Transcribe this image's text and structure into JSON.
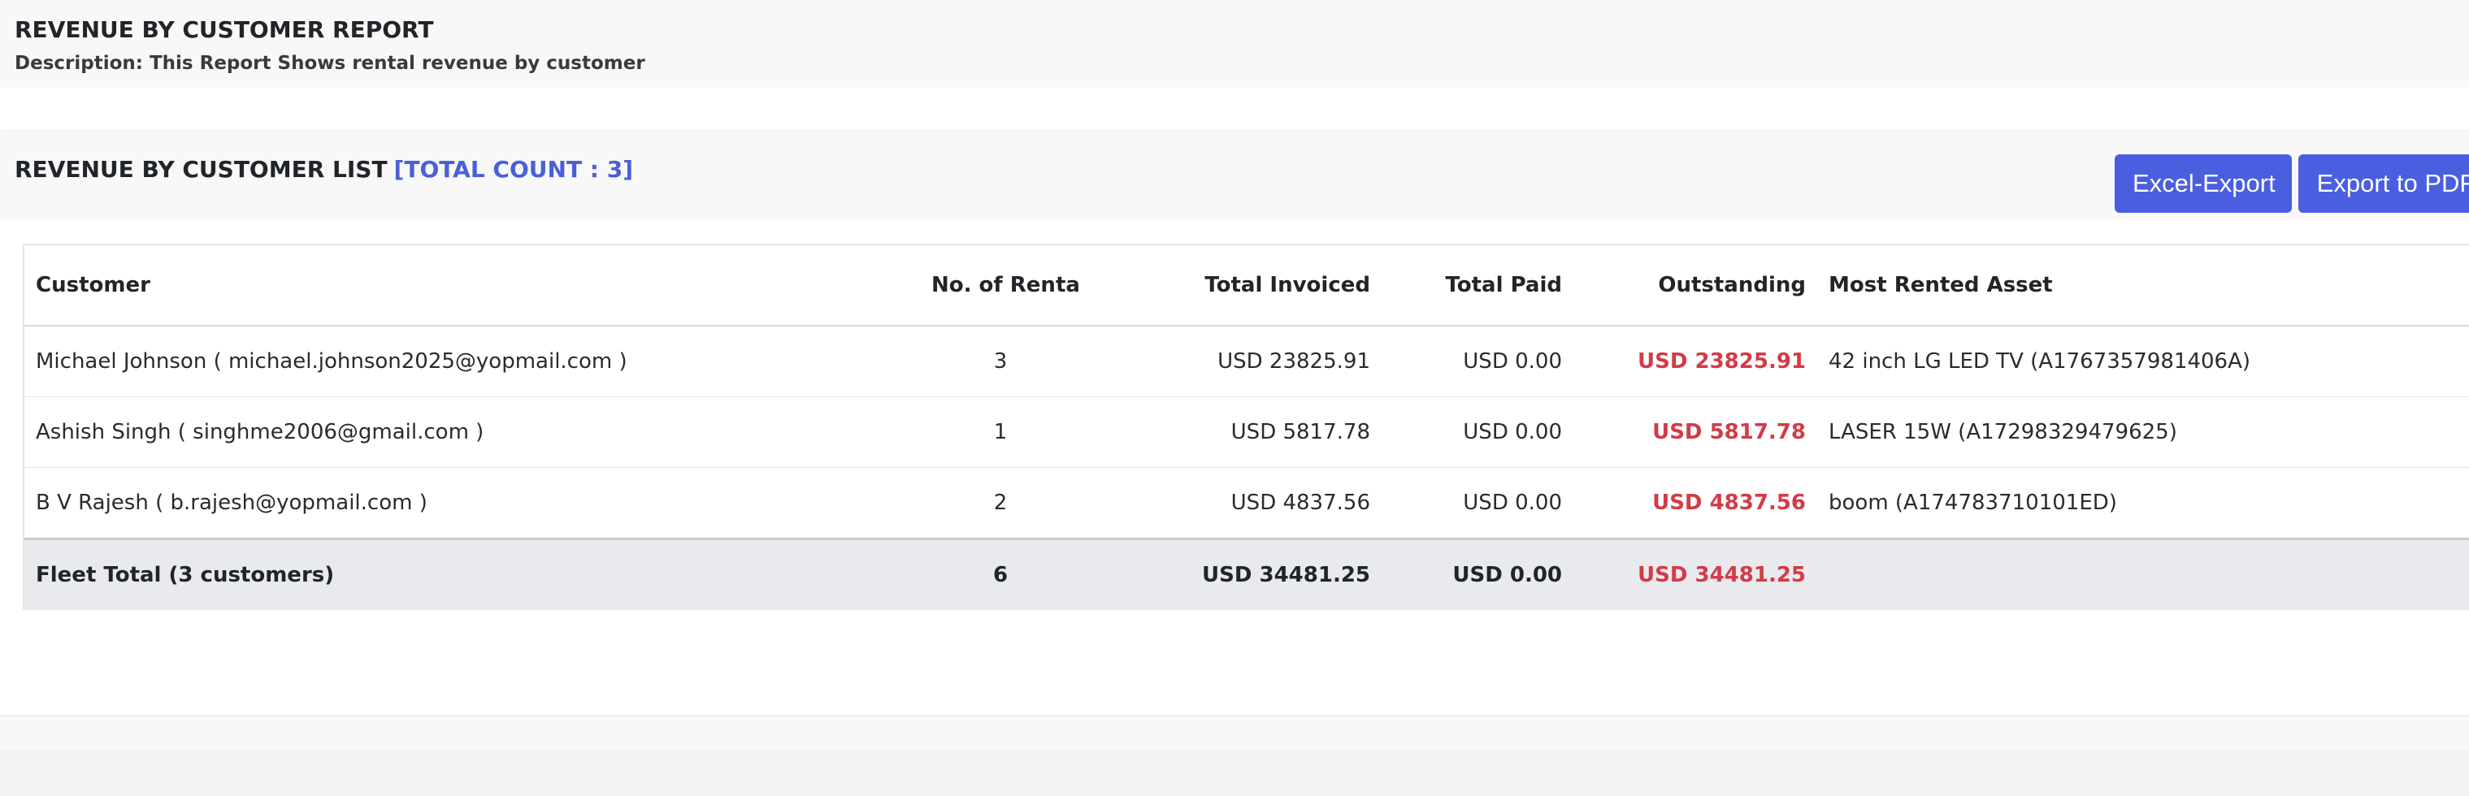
{
  "report": {
    "title": "REVENUE BY CUSTOMER REPORT",
    "description": "Description: This Report Shows rental revenue by customer"
  },
  "list": {
    "title": "REVENUE BY CUSTOMER LIST",
    "count_label": "[TOTAL COUNT : 3]",
    "excel_button": "Excel-Export",
    "pdf_button": "Export to PDF"
  },
  "table": {
    "headers": {
      "customer": "Customer",
      "rentals": "No. of Rentals",
      "invoiced": "Total Invoiced",
      "paid": "Total Paid",
      "outstanding": "Outstanding",
      "asset": "Most Rented Asset"
    },
    "rows": [
      {
        "customer": "Michael Johnson ( michael.johnson2025@yopmail.com )",
        "rentals": "3",
        "invoiced": "USD 23825.91",
        "paid": "USD 0.00",
        "outstanding": "USD 23825.91",
        "asset": "42 inch LG LED TV (A1767357981406A)"
      },
      {
        "customer": "Ashish Singh ( singhme2006@gmail.com )",
        "rentals": "1",
        "invoiced": "USD 5817.78",
        "paid": "USD 0.00",
        "outstanding": "USD 5817.78",
        "asset": "LASER 15W (A17298329479625)"
      },
      {
        "customer": "B V Rajesh ( b.rajesh@yopmail.com )",
        "rentals": "2",
        "invoiced": "USD 4837.56",
        "paid": "USD 0.00",
        "outstanding": "USD 4837.56",
        "asset": "boom (A174783710101ED)"
      }
    ],
    "footer": {
      "label": "Fleet Total (3 customers)",
      "rentals": "6",
      "invoiced": "USD 34481.25",
      "paid": "USD 0.00",
      "outstanding": "USD 34481.25",
      "asset": ""
    }
  },
  "colors": {
    "accent": "#4a5fe0",
    "count_text": "#4a5fd8",
    "outstanding": "#d33b48",
    "footer_bg": "#e9eaed"
  }
}
